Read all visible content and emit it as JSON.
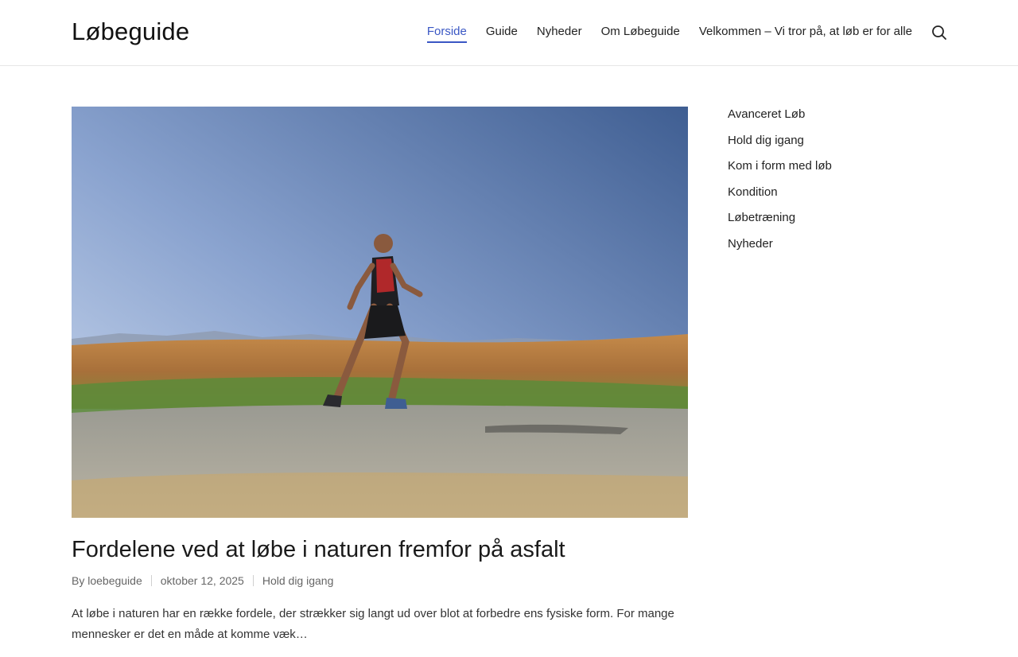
{
  "site": {
    "title": "Løbeguide"
  },
  "nav": {
    "items": [
      {
        "label": "Forside",
        "active": true
      },
      {
        "label": "Guide"
      },
      {
        "label": "Nyheder"
      },
      {
        "label": "Om Løbeguide"
      },
      {
        "label": "Velkommen – Vi tror på, at løb er for alle"
      }
    ],
    "search_icon": "search-icon"
  },
  "post": {
    "image_desc": "runner-on-gravel-path",
    "title": "Fordelene ved at løbe i naturen fremfor på asfalt",
    "meta": {
      "by_prefix": "By",
      "author": "loebeguide",
      "date": "oktober 12, 2025",
      "category": "Hold dig igang"
    },
    "excerpt": "At løbe i naturen har en række fordele, der strækker sig langt ud over blot at forbedre ens fysiske form. For mange mennesker er det en måde at komme væk…"
  },
  "sidebar": {
    "categories": [
      "Avanceret Løb",
      "Hold dig igang",
      "Kom i form med løb",
      "Kondition",
      "Løbetræning",
      "Nyheder"
    ]
  },
  "colors": {
    "accent": "#3a57c4"
  }
}
